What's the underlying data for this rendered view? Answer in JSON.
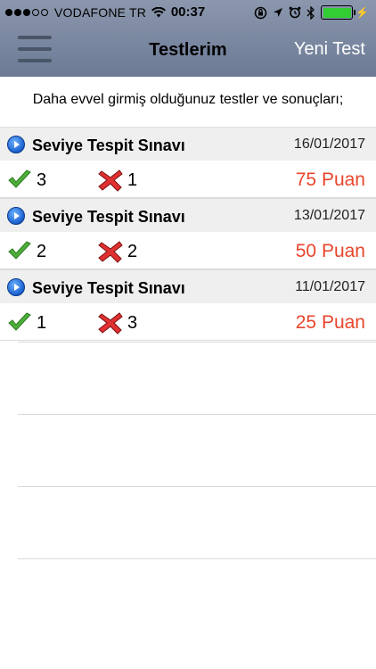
{
  "status_bar": {
    "carrier": "VODAFONE TR",
    "time": "00:37",
    "signal_filled": 3,
    "signal_total": 5,
    "battery_level": 1.0,
    "battery_color": "#32cd32"
  },
  "nav": {
    "title": "Testlerim",
    "new_test_label": "Yeni Test"
  },
  "intro_text": "Daha evvel girmiş olduğunuz testler ve sonuçları;",
  "tests": [
    {
      "name": "Seviye Tespit Sınavı",
      "date": "16/01/2017",
      "correct": "3",
      "wrong": "1",
      "score": "75 Puan"
    },
    {
      "name": "Seviye Tespit Sınavı",
      "date": "13/01/2017",
      "correct": "2",
      "wrong": "2",
      "score": "50 Puan"
    },
    {
      "name": "Seviye Tespit Sınavı",
      "date": "11/01/2017",
      "correct": "1",
      "wrong": "3",
      "score": "25 Puan"
    }
  ],
  "colors": {
    "nav_background": "#7a87a1",
    "score": "#e8452c",
    "new_test": "#ffffff"
  },
  "icons": {
    "section": "arrow-circle-icon",
    "correct": "checkmark-icon",
    "wrong": "cross-icon"
  }
}
